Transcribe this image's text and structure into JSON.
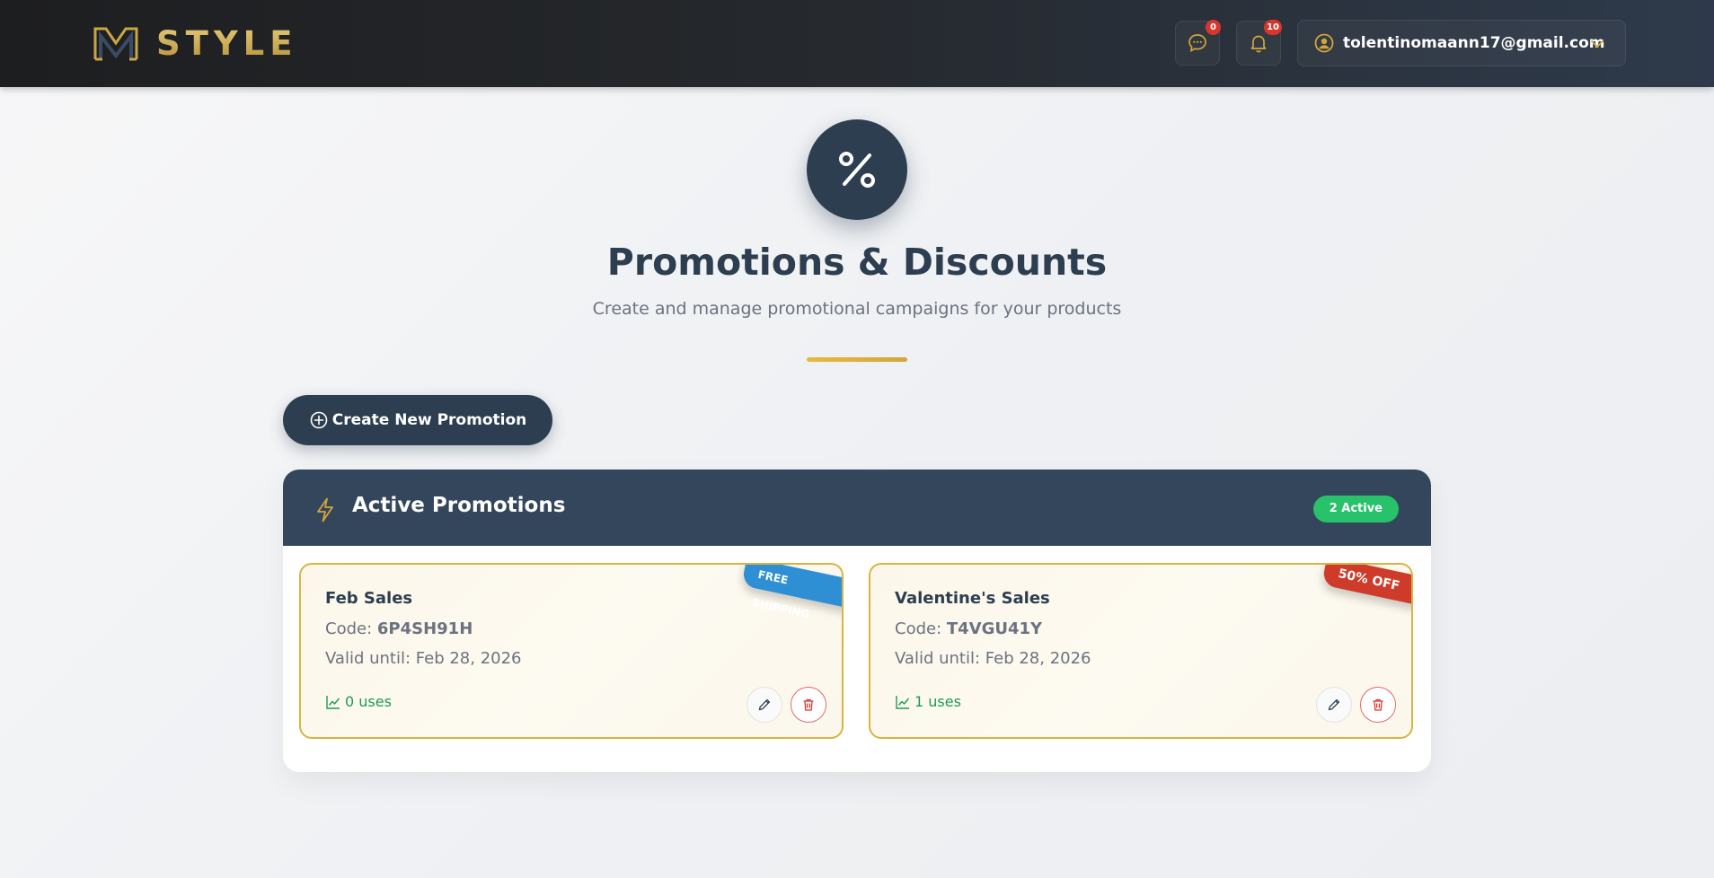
{
  "header": {
    "brand": "STYLE",
    "messages_count": "0",
    "notifications_count": "10",
    "user_email": "tolentinomaann17@gmail.com"
  },
  "hero": {
    "title": "Promotions & Discounts",
    "subtitle": "Create and manage promotional campaigns for your products"
  },
  "create_button_label": "Create New Promotion",
  "active_panel": {
    "title": "Active Promotions",
    "count_badge": "2 Active"
  },
  "promotions": [
    {
      "name": "Feb Sales",
      "code_label": "Code:",
      "code": "6P4SH91H",
      "valid_until": "Valid until: Feb 28, 2026",
      "uses": "0 uses",
      "ribbon": "FREE SHIPPING",
      "ribbon_color": "#2f8fd4"
    },
    {
      "name": "Valentine's Sales",
      "code_label": "Code:",
      "code": "T4VGU41Y",
      "valid_until": "Valid until: Feb 28, 2026",
      "uses": "1 uses",
      "ribbon": "50% OFF",
      "ribbon_color": "#cf3b2b"
    }
  ],
  "colors": {
    "navy": "#2c3e50",
    "gold": "#d4a53b",
    "green": "#27c26a",
    "red": "#d9362b"
  }
}
